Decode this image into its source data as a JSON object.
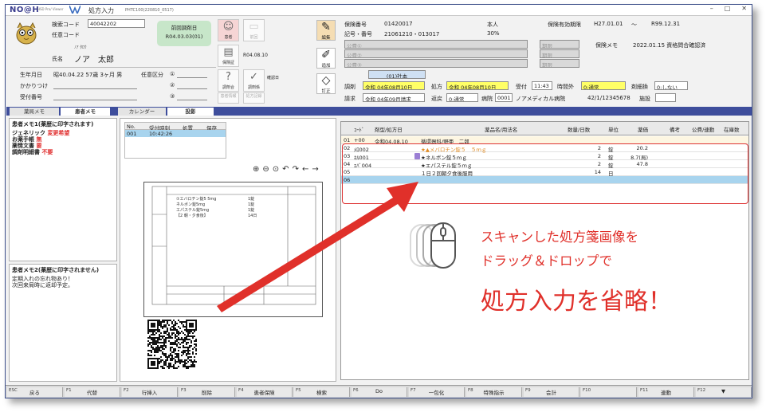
{
  "window": {
    "logo": "NO@H",
    "logo_sub": "HSD Pro/ Viewer",
    "title": "処方入力",
    "screen_id": "PHTC100(220810_0517)",
    "min": "–",
    "max": "□",
    "close": "✕"
  },
  "patient": {
    "exam_code_label": "検索コード",
    "exam_code": "40042202",
    "optional_code_label": "任意コード",
    "kana": "ﾉｱ ﾀﾛｳ",
    "name_label": "氏名",
    "name": "ノア　太郎",
    "birth_label": "生年月日",
    "birth": "昭40.04.22 57歳 3ヶ月 男",
    "category_label": "任意区分",
    "cat1": "①",
    "cat2": "②",
    "cat3": "③",
    "family_label": "かかりつけ",
    "reception_label": "受付番号"
  },
  "prev": {
    "label": "前回調剤日",
    "date": "R04.03.03(01)"
  },
  "side_buttons": {
    "memo": "患者",
    "insurance": "保険証",
    "prev_rx": "前回",
    "prev_rx_date": "R04.08.10",
    "reprint": "調剤合",
    "fee": "調剤係",
    "fee_date": "確認日",
    "patient_edit": "患者情報",
    "record": "処方記録"
  },
  "insurance": {
    "no_label": "保険番号",
    "no": "01420017",
    "type": "本人",
    "symbol_label": "記号・番号",
    "symbol": "21061210・013017",
    "rate": "30%",
    "pub1": "公費①",
    "pub2": "公費②",
    "pub3": "公費③",
    "valid_label": "保険有効期限",
    "valid_from": "H27.01.01",
    "tilde": "～",
    "valid_to": "R99.12.31",
    "period": "期限",
    "memo_label": "保険メモ",
    "memo": "2022.01.15 資格問合確認済"
  },
  "actions": {
    "edit": "編集",
    "add": "追加",
    "revise": "訂正"
  },
  "rx": {
    "tag": "(01)社本",
    "dispense_label": "調剤",
    "dispense_date": "令和 04年08月10日",
    "rx_label": "処方",
    "rx_date": "令和 04年08月10日",
    "reception_label": "受付",
    "time": "11:43",
    "time_slot_label": "時間外",
    "time_slot": "0:通常",
    "split_label": "剤細換",
    "split": "0:しない",
    "bill_label": "請求",
    "bill_month": "令和 04年09月請求",
    "return_label": "返戻",
    "return": "0:通常",
    "hospital_label": "病院",
    "hospital_code": "0001",
    "hospital": "ノアメディカル病院",
    "doctor_code": "42/1/12345678",
    "facility_label": "施設"
  },
  "tabs": [
    "薬局メモ",
    "患者メモ",
    "カレンダー",
    "投影"
  ],
  "memo": {
    "title1": "患者メモ1(薬歴に印字されます)",
    "rows": [
      {
        "k": "ジェネリック",
        "v": "変更希望"
      },
      {
        "k": "お薬手帳",
        "v": "無"
      },
      {
        "k": "薬情文書",
        "v": "要"
      },
      {
        "k": "調剤明細書",
        "v": "不要"
      }
    ],
    "title2": "患者メモ2(薬歴に印字されません)",
    "note1": "定期入れの忘れ物あり！",
    "note2": "次回来局時に返却予定。"
  },
  "history": {
    "headers": [
      "No.",
      "受付時刻",
      "処置",
      "保存"
    ],
    "row": {
      "no": "001",
      "time": "10:42:26"
    }
  },
  "toolbar_icons": [
    "zoom-in",
    "zoom-out",
    "zoom-fit",
    "rotate-left",
    "rotate-right",
    "back",
    "forward"
  ],
  "grid": {
    "headers": [
      "ｺｰﾄﾞ",
      "剤型/処方日",
      "薬品名/用法名",
      "数量/日数",
      "単位",
      "薬価",
      "備考",
      "公費/連動",
      "在庫数"
    ],
    "rows": [
      {
        "no": "01",
        "code": "+00",
        "date": "令和04.08.10",
        "name": "循環器科/野亜　二郎",
        "qty": "",
        "unit": "",
        "price": ""
      },
      {
        "no": "02",
        "code": "ﾒﾛ002",
        "date": "",
        "name": "★▲メバロチン錠５　５ｍｇ",
        "qty": "2",
        "unit": "錠",
        "price": "20.2"
      },
      {
        "no": "03",
        "code": "ﾈﾙ001",
        "date": "",
        "name": "★ネルボン錠５ｍｇ",
        "qty": "2",
        "unit": "錠",
        "price": "8.7(局)"
      },
      {
        "no": "04",
        "code": "ｴﾊﾞ004",
        "date": "",
        "name": "★エパステル錠５ｍｇ",
        "qty": "2",
        "unit": "錠",
        "price": "47.8"
      },
      {
        "no": "05",
        "code": "",
        "date": "",
        "name": "１日２回朝夕食後服用",
        "qty": "14",
        "unit": "日",
        "price": ""
      },
      {
        "no": "06",
        "code": "",
        "date": "",
        "name": "",
        "qty": "",
        "unit": "",
        "price": ""
      }
    ]
  },
  "document": {
    "lines": [
      "①エバロチン錠5 5mg",
      "ネルボン錠5mg",
      "エパステル錠5mg",
      "【2 朝・夕食後】",
      "1錠",
      "1錠",
      "1錠",
      "14日"
    ]
  },
  "overlay": {
    "line1": "スキャンした処方箋画像を",
    "line2": "ドラッグ＆ドロップで",
    "line3": "処方入力を省略！"
  },
  "fkeys": [
    {
      "n": "ESC",
      "l": "戻る"
    },
    {
      "n": "F1",
      "l": "代替"
    },
    {
      "n": "F2",
      "l": "行挿入"
    },
    {
      "n": "F3",
      "l": "削除"
    },
    {
      "n": "F4",
      "l": "患者保険"
    },
    {
      "n": "F5",
      "l": "検索"
    },
    {
      "n": "F6",
      "l": "Do"
    },
    {
      "n": "F7",
      "l": "一包化"
    },
    {
      "n": "F8",
      "l": "特殊指示"
    },
    {
      "n": "F9",
      "l": "会計"
    },
    {
      "n": "F10",
      "l": ""
    },
    {
      "n": "F11",
      "l": "連動"
    },
    {
      "n": "F12",
      "l": "▼"
    }
  ],
  "colors": {
    "accent": "#3e4e9c",
    "overlay_red": "#e0302a",
    "selection": "#a8d4ee",
    "highlight": "#ffff66"
  }
}
